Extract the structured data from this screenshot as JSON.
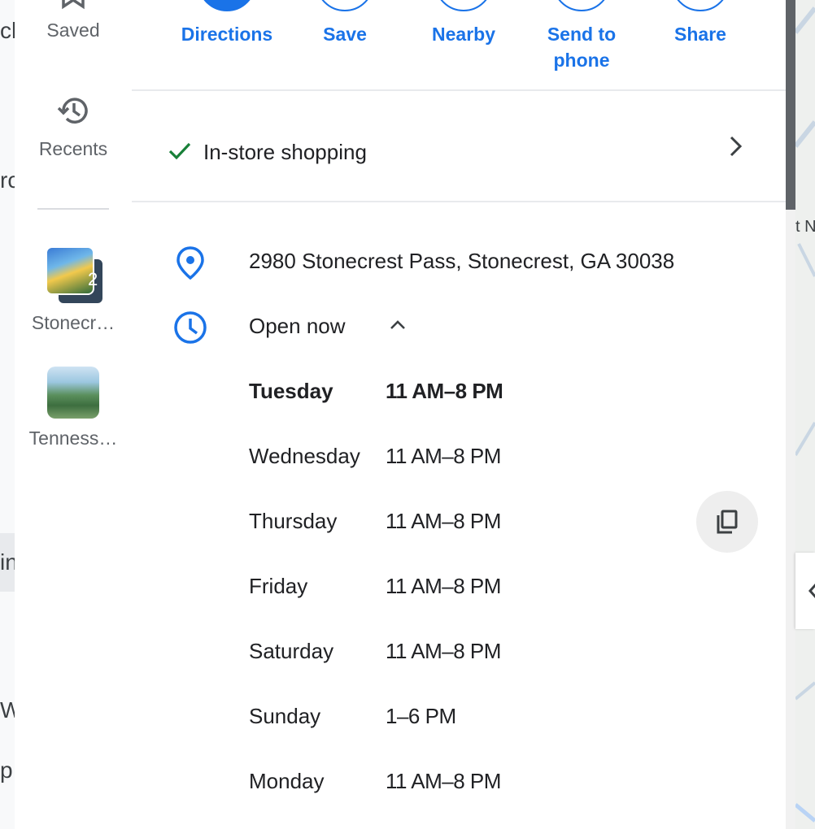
{
  "background_fragments": [
    "ch",
    "rc",
    "in",
    "We",
    "p"
  ],
  "map_fragment": "t N",
  "rail": {
    "saved_label": "Saved",
    "recents_label": "Recents",
    "recent_places": [
      {
        "label": "Stonecr…",
        "count": "2"
      },
      {
        "label": "Tenness…"
      }
    ]
  },
  "actions": [
    {
      "label": "Directions",
      "icon": "directions-icon"
    },
    {
      "label": "Save",
      "icon": "bookmark-icon"
    },
    {
      "label": "Nearby",
      "icon": "nearby-icon"
    },
    {
      "label": "Send to phone",
      "icon": "phone-icon"
    },
    {
      "label": "Share",
      "icon": "share-icon"
    }
  ],
  "service_option": {
    "label": "In-store shopping",
    "icon": "check-icon"
  },
  "address": "2980 Stonecrest Pass, Stonecrest, GA 30038",
  "open_status": "Open now",
  "hours": [
    {
      "day": "Tuesday",
      "time": "11 AM–8 PM",
      "current": true
    },
    {
      "day": "Wednesday",
      "time": "11 AM–8 PM"
    },
    {
      "day": "Thursday",
      "time": "11 AM–8 PM"
    },
    {
      "day": "Friday",
      "time": "11 AM–8 PM"
    },
    {
      "day": "Saturday",
      "time": "11 AM–8 PM"
    },
    {
      "day": "Sunday",
      "time": "1–6 PM"
    },
    {
      "day": "Monday",
      "time": "11 AM–8 PM"
    }
  ],
  "colors": {
    "accent": "#1a73e8",
    "check": "#188038",
    "text": "#202124",
    "muted": "#5f6368"
  }
}
